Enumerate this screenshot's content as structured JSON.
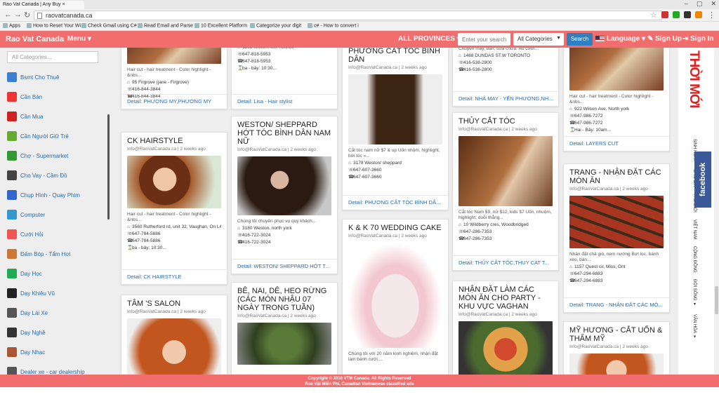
{
  "browser": {
    "tab_title": "Rao Vat Canada | Any Buy",
    "url": "raovatcanada.ca",
    "bookmarks": [
      {
        "label": "Apps"
      },
      {
        "label": "How to Reset Your Wi"
      },
      {
        "label": "Check Gmail using C#"
      },
      {
        "label": "Read Email and Parse"
      },
      {
        "label": "10 Excellent Platform"
      },
      {
        "label": "Categorize your digit"
      },
      {
        "label": "c# - How to convert i"
      }
    ]
  },
  "header": {
    "brand": "Rao Vat Canada",
    "menu": "Menu ▾",
    "provinces": "ALL PROVINCES ▾",
    "search_placeholder": "Enter your search",
    "categories": "All Categories",
    "search_button": "Search",
    "language": "Language ▾",
    "signup": "Sign Up",
    "signin": "Sign In",
    "colors": {
      "brand": "#f26e6e",
      "button": "#2f7fc3"
    }
  },
  "sidebar": {
    "search_placeholder": "All Categories...",
    "items": [
      {
        "label": "Bsmt Cho Thuê",
        "icon": "house-icon",
        "color": "#3a7fd0"
      },
      {
        "label": "Cần Bán",
        "icon": "sale-tag-icon",
        "color": "#e33"
      },
      {
        "label": "Cần Mua",
        "icon": "cart-icon",
        "color": "#c22"
      },
      {
        "label": "Cần Người Giữ Trẻ",
        "icon": "baby-stroller-icon",
        "color": "#6a3"
      },
      {
        "label": "Chợ - Supermarket",
        "icon": "store-icon",
        "color": "#393"
      },
      {
        "label": "Cho Vay - Cầm Đồ",
        "icon": "person-icon",
        "color": "#444"
      },
      {
        "label": "Chụp Hình - Quay Phim",
        "icon": "camera-icon",
        "color": "#36c"
      },
      {
        "label": "Computer",
        "icon": "computer-icon",
        "color": "#39c"
      },
      {
        "label": "Cưới Hỏi",
        "icon": "rings-icon",
        "color": "#e55"
      },
      {
        "label": "Đấm Bóp - Tẩm Hơi",
        "icon": "massage-icon",
        "color": "#c73"
      },
      {
        "label": "Day Học",
        "icon": "chalkboard-icon",
        "color": "#2a5"
      },
      {
        "label": "Dạy Khiêu Vũ",
        "icon": "dancer-icon",
        "color": "#222"
      },
      {
        "label": "Dạy Lái Xe",
        "icon": "steering-wheel-icon",
        "color": "#555"
      },
      {
        "label": "Dạy Nghề",
        "icon": "tools-icon",
        "color": "#333"
      },
      {
        "label": "Dạy Nhạc",
        "icon": "guitar-icon",
        "color": "#a53"
      },
      {
        "label": "Dealer xe - car dealership",
        "icon": "car-icon",
        "color": "#555"
      }
    ]
  },
  "cards": [
    {
      "id": "c1",
      "title": "",
      "meta": "",
      "desc": "Hair cut - hair treatment - Color highlight - &nbs...",
      "address": "95 Firgrove (jane - Firgrove)",
      "phone1": "416-844-3844",
      "phone2": "416-844-3844",
      "hours": "",
      "footer": "Detail: PHƯỢNG MY,PHƯƠNG MY"
    },
    {
      "id": "c2",
      "title": "",
      "meta": "",
      "desc": "&nbs...",
      "address": "1363 Wilson Ave, Toronto",
      "phone1": "647-818-5953",
      "phone2": "647-818-5953",
      "hours": "ba - bảy: 10:30...",
      "footer": "Detail: Lisa - Hair stylist"
    },
    {
      "id": "c3",
      "title": "PHƯƠNG CẮT TÓC BÌNH DÂN",
      "meta": "Info@RaoVatCanada.ca | 2 weeks ago",
      "desc": "Cắt tóc nam nữ $7 & up Uốn nhộm, highlight, bới tóc «...",
      "address": "3178 Weston/ sheppard",
      "phone1": "647-607-3660",
      "phone2": "647-607-3660",
      "hours": "",
      "footer": "Detail: PHƯƠNG CẮT TÓC BÌNH DÂ..."
    },
    {
      "id": "c4",
      "title": "",
      "meta": "",
      "desc": "Chuyên may, bán, sửa chữa: Áo cưới...",
      "address": "1468 DUNDAS ST.W TORONTO",
      "phone1": "416-538-2800",
      "phone2": "416-538-2800",
      "hours": "",
      "footer": "Detail: NHÀ MAY - YẾN PHƯƠNG,NH..."
    },
    {
      "id": "c5",
      "title": "",
      "meta": "",
      "desc": "Hair cut - hair treatment - Color highlight - &nbs...",
      "address": "922 Wilson Ave, North york",
      "phone1": "647-986-7272",
      "phone2": "647-986-7272",
      "hours": "Hai - Bảy: 10am...",
      "footer": "Detail: LAYERS CUT"
    },
    {
      "id": "c6",
      "title": "CK HAIRSTYLE",
      "meta": "Info@RaoVatCanada.ca | 2 weeks ago",
      "desc": "Hair cut - hair treatment - Color highlight - &nbs...",
      "address": "3560 Rutherford rd, unit 32, Vaughan, On L4H 3T8",
      "phone1": "647-784-5886",
      "phone2": "647-784-5886",
      "hours": "ba - bảy: 10:30...",
      "footer": "Detail: CK HAIRSTYLE"
    },
    {
      "id": "c7",
      "title": "WESTON/ SHEPPARD HỚT TÓC BÌNH DÂN NAM NỮ",
      "meta": "Info@RaoVatCanada.ca | 2 weeks ago",
      "desc": "Chúng tôi chuyên phục vụ quý khách...",
      "address": "3180 Weston, north york",
      "phone1": "416-722-3024",
      "phone2": "416-722-3024",
      "hours": "",
      "footer": "Detail: WESTON/ SHEPPARD HỚT T..."
    },
    {
      "id": "c8",
      "title": "THỦY CẮT TÓC",
      "meta": "Info@RaoVatCanada.ca | 2 weeks ago",
      "desc": "Cắt tóc Nam $9, nữ $12, kids $7 Uốn, nhuộm, highlight, duỗi thẳng...",
      "address": "10 Wildberry cres, Woodbridged",
      "phone1": "647-286-7353",
      "phone2": "647-286-7353",
      "hours": "",
      "footer": "Detail: THỦY CẮT TÓC,THUY CAT T..."
    },
    {
      "id": "c9",
      "title": "TRANG - NHẬN ĐẶT CÁC MÓN ĂN",
      "meta": "Info@RaoVatCanada.ca | 2 weeks ago",
      "desc": "Nhận đặt chả giò, nem nướng Bợt lọc, bánh xèo, bán...",
      "address": "1157 Quest cir, Miss, Ont",
      "phone1": "647-294-6883",
      "phone2": "647-294-6883",
      "hours": "",
      "footer": "Detail: TRANG - NHẬN ĐẶT CÁC MÓ..."
    },
    {
      "id": "c10",
      "title": "K & K 70 WEDDING CAKE",
      "meta": "Info@RaoVatCanada.ca | 2 weeks ago",
      "desc": "Chúng tôi với 20 năm kinh nghiệm, nhận đặt làm bánh cưới,...",
      "address": "",
      "phone1": "",
      "phone2": "",
      "hours": "",
      "footer": ""
    },
    {
      "id": "c11",
      "title": "TÂM 'S SALON",
      "meta": "Info@RaoVatCanada.ca | 2 weeks ago",
      "desc": "",
      "address": "",
      "phone1": "",
      "phone2": "",
      "hours": "",
      "footer": ""
    },
    {
      "id": "c12",
      "title": "BÊ, NAI, DÊ, HEO RỪNG (CÁC MÓN NHẬU 07 NGÀY TRONG TUẦN)",
      "meta": "Info@RaoVatCanada.ca | 2 weeks ago",
      "desc": "",
      "address": "",
      "phone1": "",
      "phone2": "",
      "hours": "",
      "footer": ""
    },
    {
      "id": "c13",
      "title": "NHẬN ĐẶT LÀM CÁC MÓN ĂN CHO PARTY - khu vực Vaghan",
      "meta": "Info@RaoVatCanada.ca | 2 weeks ago",
      "desc": "",
      "address": "",
      "phone1": "",
      "phone2": "",
      "hours": "",
      "footer": ""
    },
    {
      "id": "c14",
      "title": "MỸ HƯƠNG - CẮT UỐN & THẨM MỸ",
      "meta": "Info@RaoVatCanada.ca | 2 weeks ago",
      "desc": "",
      "address": "",
      "phone1": "",
      "phone2": "",
      "hours": "",
      "footer": ""
    }
  ],
  "ads": {
    "logo": "THỜI MỚI",
    "nav": [
      "SINH HOẠT",
      "CANADA",
      "THẾ GIỚI",
      "VIỆT NAM",
      "CỘNG ĐỒNG",
      "ĐỜI SỐNG ▾",
      "VĂN HÓA ▾"
    ],
    "facebook": "facebook"
  },
  "footer": {
    "line1": "Copyright © 2016 VTM Canada. All Rights Reserved",
    "line2": "Rao Vặt Miễn Phí, Canadian Vietnamese classified ads"
  }
}
